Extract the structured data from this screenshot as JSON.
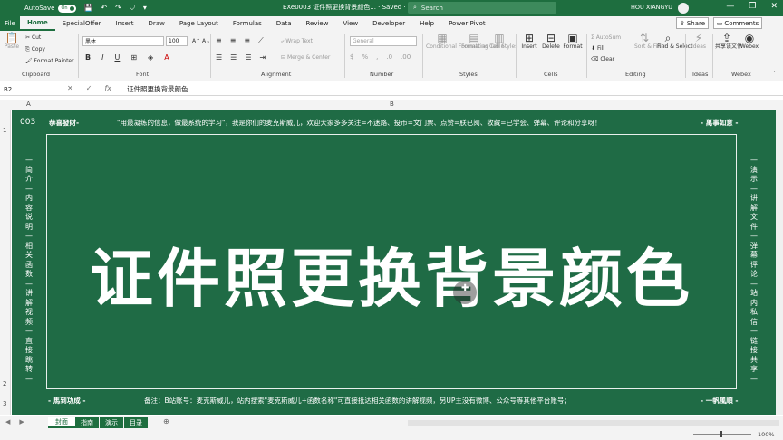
{
  "titlebar": {
    "autosave_label": "AutoSave",
    "autosave_state": "On",
    "doc_title": "EXe0003 证件照更换背景颜色... · Saved ·",
    "search_placeholder": "Search",
    "user_name": "HOU XIANGYU",
    "minimize": "—",
    "maximize": "❐",
    "close": "✕"
  },
  "menu": {
    "file": "File",
    "tabs": [
      "Home",
      "SpecialOffer",
      "Insert",
      "Draw",
      "Page Layout",
      "Formulas",
      "Data",
      "Review",
      "View",
      "Developer",
      "Help",
      "Power Pivot"
    ],
    "share": "Share",
    "comments": "Comments"
  },
  "ribbon": {
    "clipboard": {
      "label": "Clipboard",
      "paste": "Paste",
      "cut": "Cut",
      "copy": "Copy",
      "format_painter": "Format Painter"
    },
    "font": {
      "label": "Font",
      "font_name": "黑体",
      "font_size": "100"
    },
    "alignment": {
      "label": "Alignment",
      "wrap_text": "Wrap Text",
      "merge_center": "Merge & Center"
    },
    "number": {
      "label": "Number",
      "format": "General"
    },
    "styles": {
      "label": "Styles",
      "conditional": "Conditional Formatting",
      "format_as_table": "Format as Table",
      "cell_styles": "Cell Styles"
    },
    "cells": {
      "label": "Cells",
      "insert": "Insert",
      "delete": "Delete",
      "format": "Format"
    },
    "editing": {
      "label": "Editing",
      "autosum": "AutoSum",
      "fill": "Fill",
      "clear": "Clear",
      "sort_filter": "Sort & Filter",
      "find_select": "Find & Select"
    },
    "ideas": {
      "label": "Ideas",
      "ideas": "Ideas"
    },
    "webex": {
      "label": "Webex",
      "share_file": "共享该文件",
      "webex": "Webex"
    }
  },
  "formula_bar": {
    "name_box": "B2",
    "cancel": "✕",
    "enter": "✓",
    "fx": "fx",
    "content": "证件照更换背景颜色"
  },
  "columns": [
    "A",
    "B"
  ],
  "rows": [
    "1",
    "2",
    "3"
  ],
  "sheet": {
    "top_code": "003",
    "top_left": "恭喜發財-",
    "top_slogan": "\"用最凝练的信息，做最系统的学习\"，我是你们的麦克斯威儿，欢迎大家多多关注=不迷路、投币=文门票、点赞=朕已阅、收藏=已学会、弹幕、评论和分享呀！",
    "top_right": "- 萬事如意 -",
    "left_vertical": "—简介—内容说明—相关函数—讲解视频—直接跳转—",
    "right_vertical": "—演示—讲解文件—弹幕评论—站内私信—链接共享—",
    "main_title": "证件照更换背景颜色",
    "bottom_left": "- 馬到功成 -",
    "bottom_note": "备注：B站账号：麦克斯威儿，站内搜索\"麦克斯威儿+函数名称\"可直接抵达相关函数的讲解视频，另UP主没有微博、公众号等其他平台账号；",
    "bottom_right": "- 一帆風順 -"
  },
  "sheet_tabs": [
    "封面",
    "指南",
    "演示",
    "目录"
  ],
  "add_sheet": "⊕",
  "status": {
    "zoom": "100%"
  },
  "colors": {
    "excel_green": "#1e6e3f",
    "sheet_bg": "#1f6b45"
  }
}
